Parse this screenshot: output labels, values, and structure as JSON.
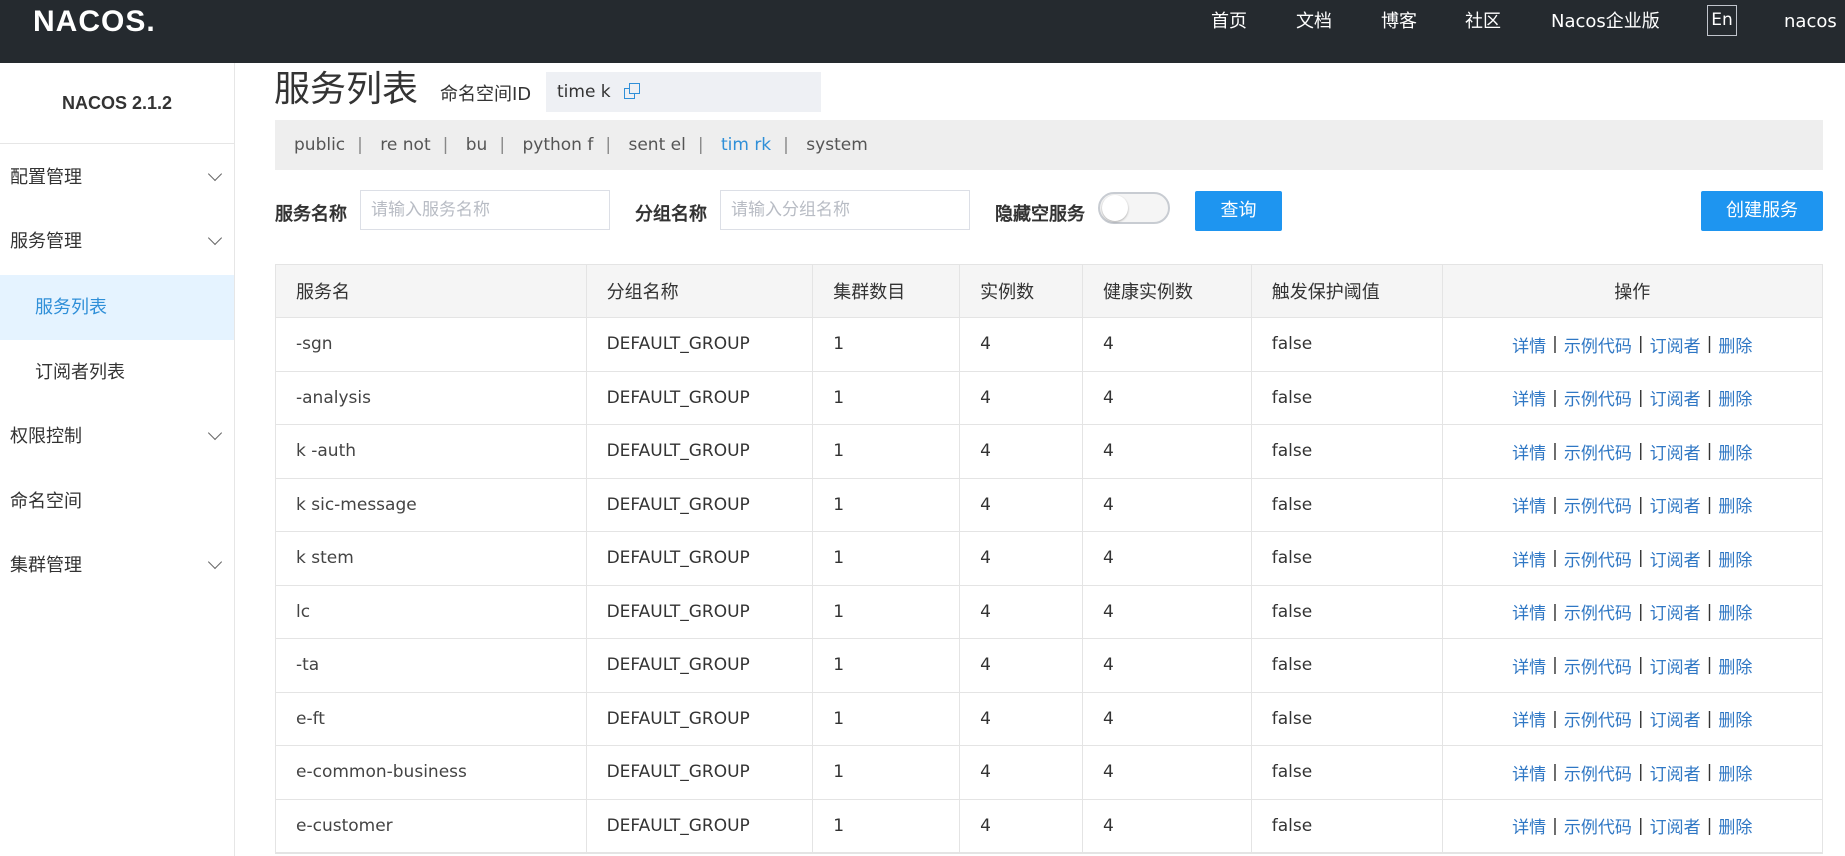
{
  "header": {
    "logo": "NACOS.",
    "nav": [
      {
        "label": "首页"
      },
      {
        "label": "文档"
      },
      {
        "label": "博客"
      },
      {
        "label": "社区"
      },
      {
        "label": "Nacos企业版"
      }
    ],
    "lang_button": "En",
    "user": "nacos"
  },
  "sidebar": {
    "version": "NACOS 2.1.2",
    "items": [
      {
        "label": "配置管理",
        "expandable": true
      },
      {
        "label": "服务管理",
        "expandable": true
      },
      {
        "label": "服务列表",
        "sub": true,
        "active": true
      },
      {
        "label": "订阅者列表",
        "sub": true
      },
      {
        "label": "权限控制",
        "expandable": true
      },
      {
        "label": "命名空间"
      },
      {
        "label": "集群管理",
        "expandable": true
      }
    ]
  },
  "main": {
    "title": "服务列表",
    "namespace_label": "命名空间ID",
    "namespace_value": "time  k",
    "namespaces": [
      {
        "label": "public"
      },
      {
        "label": "re not"
      },
      {
        "label": "bu"
      },
      {
        "label": "python   f"
      },
      {
        "label": "sent el"
      },
      {
        "label": "tim  rk",
        "current": true
      },
      {
        "label": "system"
      }
    ],
    "filters": {
      "service_name_label": "服务名称",
      "service_name_placeholder": "请输入服务名称",
      "group_name_label": "分组名称",
      "group_name_placeholder": "请输入分组名称",
      "hide_empty_label": "隐藏空服务",
      "hide_empty_on": false,
      "query_button": "查询",
      "create_button": "创建服务"
    },
    "table": {
      "columns": [
        "服务名",
        "分组名称",
        "集群数目",
        "实例数",
        "健康实例数",
        "触发保护阈值",
        "操作"
      ],
      "actions": [
        "详情",
        "示例代码",
        "订阅者",
        "删除"
      ],
      "rows": [
        {
          "name": "-sgn",
          "group": "DEFAULT_GROUP",
          "clusters": "1",
          "instances": "4",
          "healthy": "4",
          "threshold": "false"
        },
        {
          "name": "-analysis",
          "group": "DEFAULT_GROUP",
          "clusters": "1",
          "instances": "4",
          "healthy": "4",
          "threshold": "false"
        },
        {
          "name": "k -auth",
          "group": "DEFAULT_GROUP",
          "clusters": "1",
          "instances": "4",
          "healthy": "4",
          "threshold": "false"
        },
        {
          "name": "k  sic-message",
          "group": "DEFAULT_GROUP",
          "clusters": "1",
          "instances": "4",
          "healthy": "4",
          "threshold": "false"
        },
        {
          "name": "k  stem",
          "group": "DEFAULT_GROUP",
          "clusters": "1",
          "instances": "4",
          "healthy": "4",
          "threshold": "false"
        },
        {
          "name": "lc",
          "group": "DEFAULT_GROUP",
          "clusters": "1",
          "instances": "4",
          "healthy": "4",
          "threshold": "false"
        },
        {
          "name": "-ta",
          "group": "DEFAULT_GROUP",
          "clusters": "1",
          "instances": "4",
          "healthy": "4",
          "threshold": "false"
        },
        {
          "name": "e-ft",
          "group": "DEFAULT_GROUP",
          "clusters": "1",
          "instances": "4",
          "healthy": "4",
          "threshold": "false"
        },
        {
          "name": "e-common-business",
          "group": "DEFAULT_GROUP",
          "clusters": "1",
          "instances": "4",
          "healthy": "4",
          "threshold": "false"
        },
        {
          "name": "e-customer",
          "group": "DEFAULT_GROUP",
          "clusters": "1",
          "instances": "4",
          "healthy": "4",
          "threshold": "false"
        }
      ]
    }
  }
}
